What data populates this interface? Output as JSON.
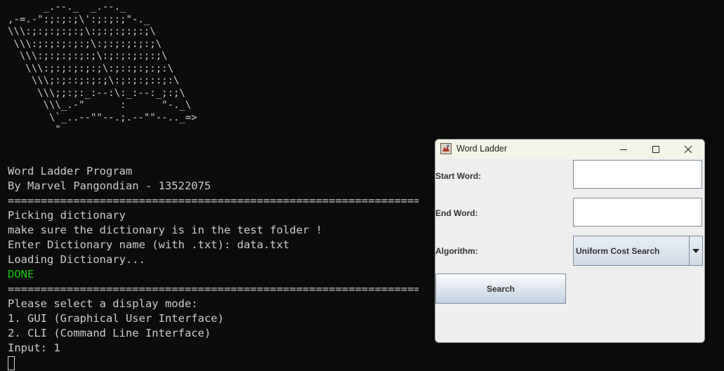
{
  "terminal": {
    "ascii_art": "      _.--._  _.--._\n,-=.-\":;:;:;\\':;:;:;\"-._\n\\\\\\:;:;:;:;:;\\:;:;:;:;:;\\\n \\\\\\:;:;:;:;:;\\:;:;:;:;:;\\\n  \\\\\\:;:;:;:;:;\\:;:;:;:;:;\\\n   \\\\\\:;:;:;:;:;\\:;::;:;:;:\\\n    \\\\\\;:;::;:;:;\\:;:;:;::;:\\\n     \\\\\\;;:;:_:--:\\:_:--:_;:;\\\n      \\\\\\_.-\"      :      \"-._\\\n       \\`_..--\"\"--.;.--\"\"--.._=>\n        \"",
    "lines": [
      "Word Ladder Program",
      "By Marvel Pangondian - 13522075",
      "===================================================================",
      "Picking dictionary",
      "make sure the dictionary is in the test folder !",
      "Enter Dictionary name (with .txt): data.txt",
      "Loading Dictionary...",
      "DONE",
      "===================================================================",
      "Please select a display mode:",
      "1. GUI (Graphical User Interface)",
      "2. CLI (Command Line Interface)",
      "Input: 1"
    ]
  },
  "window": {
    "title": "Word Ladder",
    "start_label": "Start Word:",
    "start_value": "",
    "end_label": "End Word:",
    "end_value": "",
    "algorithm_label": "Algorithm:",
    "algorithm_selected": "Uniform Cost Search",
    "search_label": "Search",
    "icons": [
      "app-icon",
      "minimize-icon",
      "maximize-icon",
      "close-icon",
      "dropdown-arrow-icon"
    ]
  },
  "colors": {
    "terminal_bg": "#0c0c0c",
    "terminal_text": "#cccccc",
    "success": "#16c60c",
    "window_bg": "#eeeeee"
  }
}
